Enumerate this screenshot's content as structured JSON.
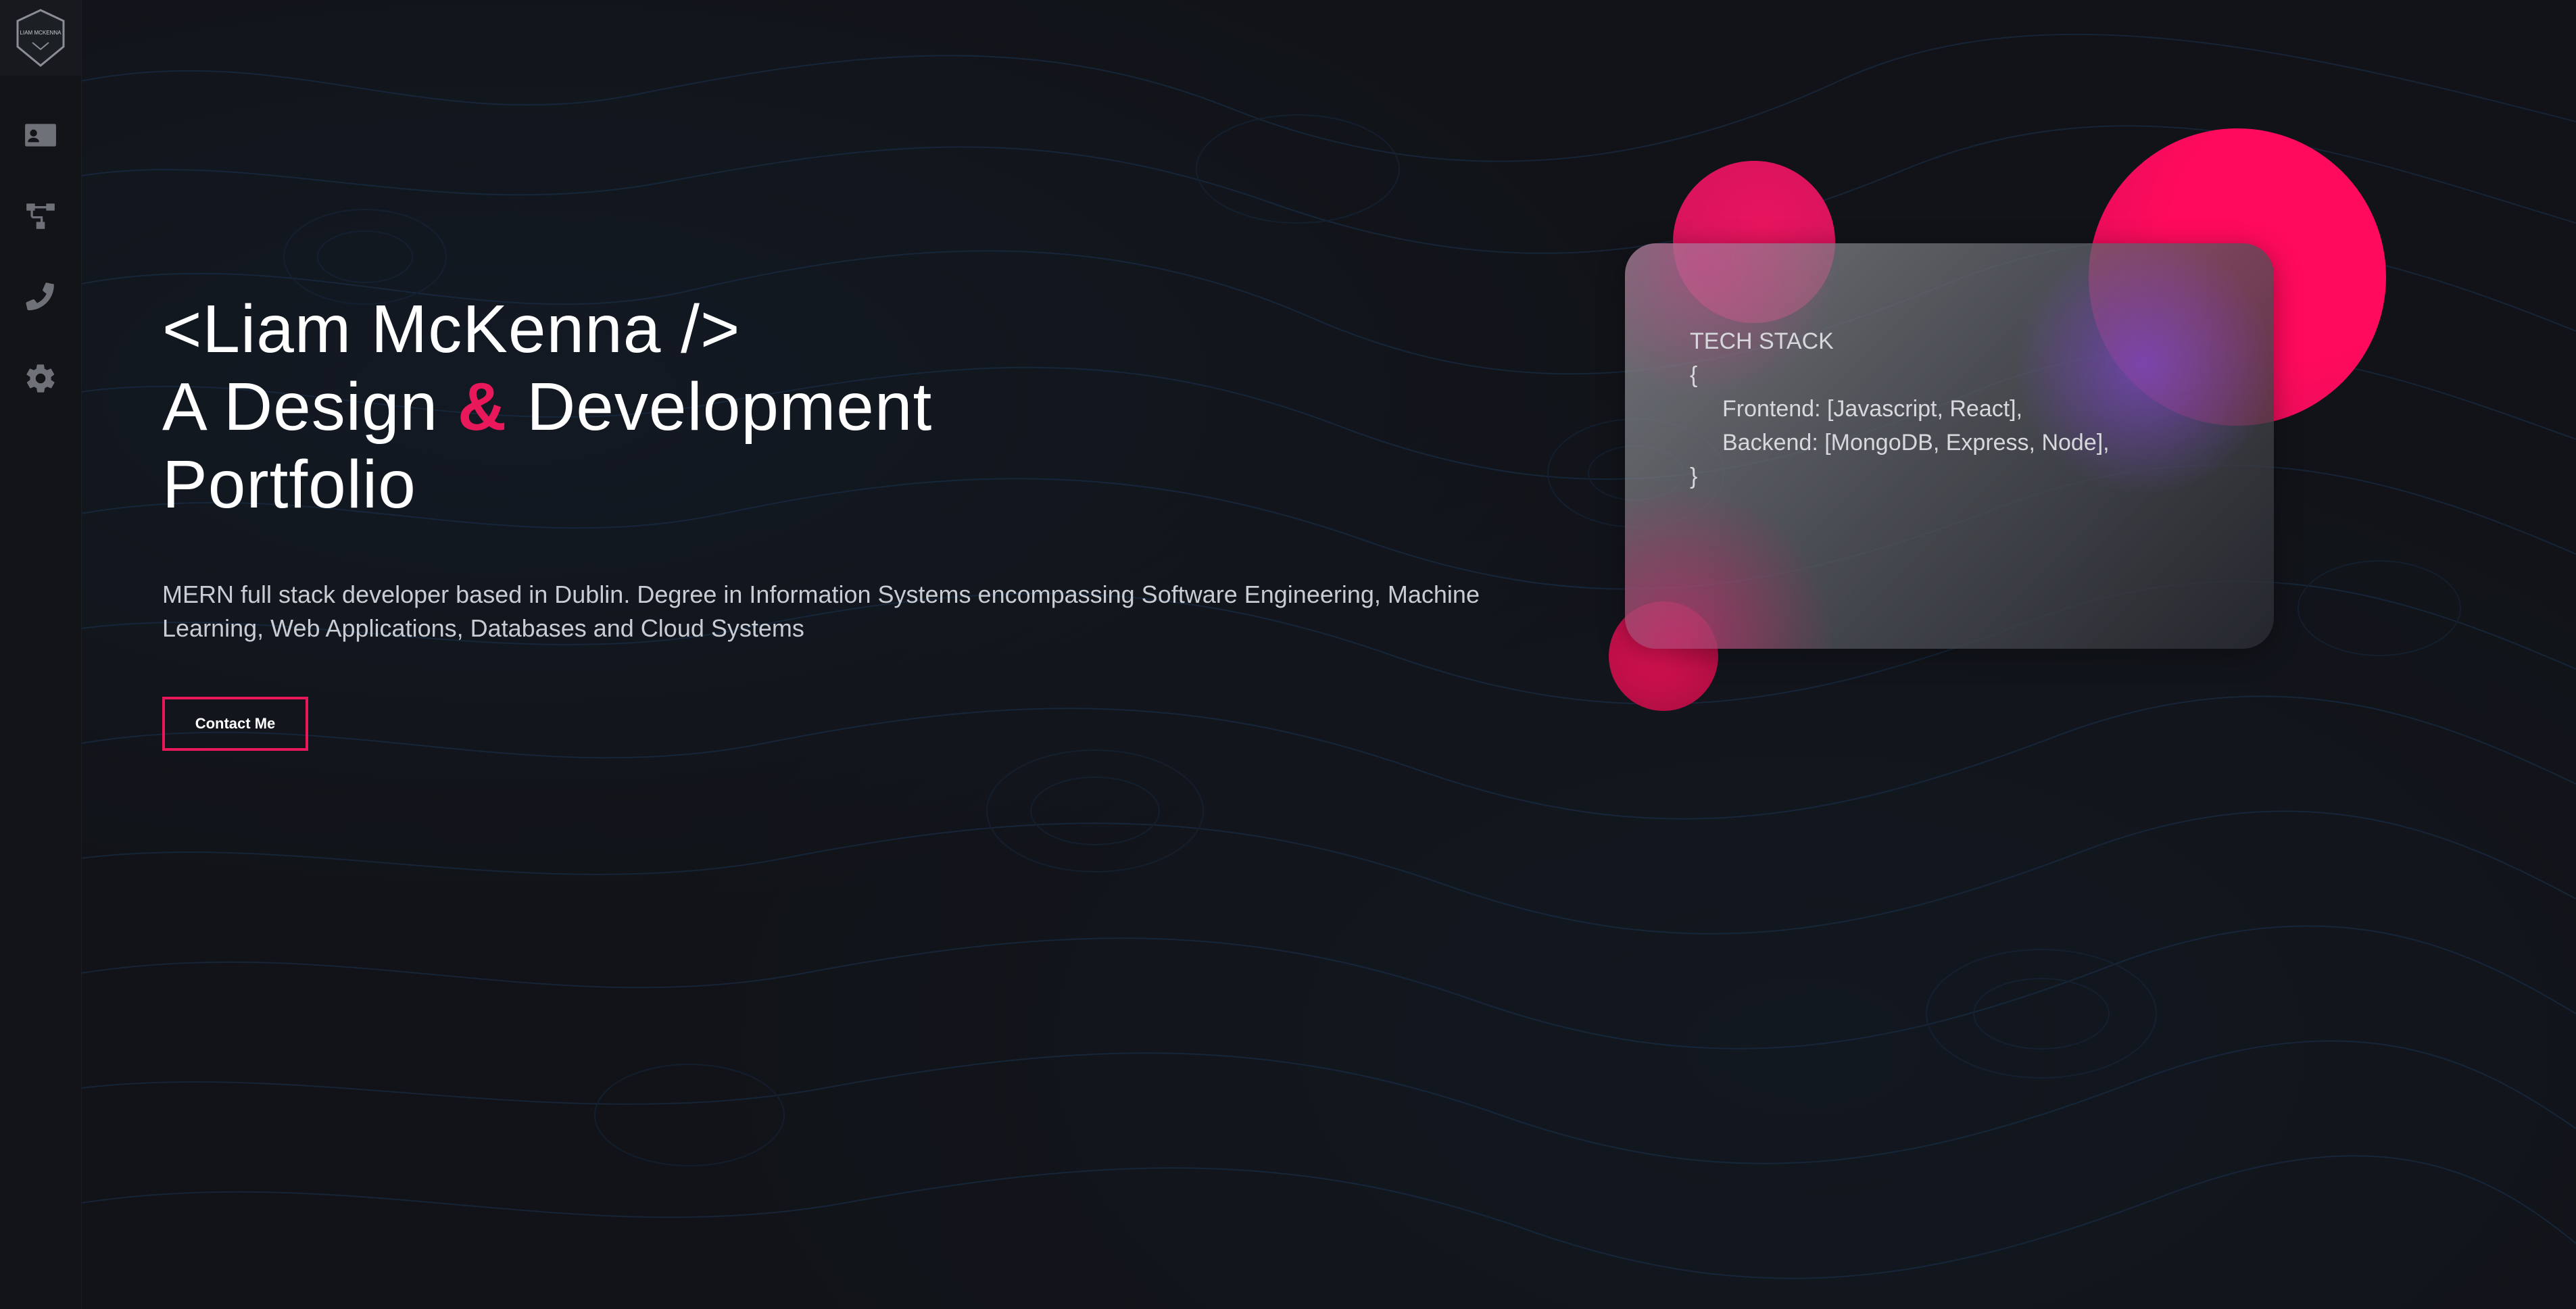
{
  "sidebar": {
    "logo_text": "LIAM MCKENNA",
    "items": [
      {
        "icon": "id-card-icon",
        "label": "About"
      },
      {
        "icon": "sitemap-icon",
        "label": "Projects"
      },
      {
        "icon": "phone-icon",
        "label": "Contact"
      },
      {
        "icon": "gear-icon",
        "label": "Settings"
      }
    ]
  },
  "hero": {
    "title_line1": "<Liam McKenna />",
    "title_line2_a": "A Design",
    "title_line2_amp": "&",
    "title_line2_b": "Development",
    "title_line3": "Portfolio",
    "description": "MERN full stack developer based in Dublin. Degree in Information Systems encompassing Software Engineering, Machine Learning, Web Applications, Databases and Cloud Systems",
    "button_label": "Contact Me"
  },
  "tech_card": {
    "heading": "TECH STACK",
    "open_brace": "{",
    "frontend": "Frontend: [Javascript, React],",
    "backend": "Backend: [MongoDB, Express, Node],",
    "close_brace": "}"
  },
  "colors": {
    "accent": "#e8185a",
    "background": "#111318",
    "sidebar": "#121418"
  }
}
